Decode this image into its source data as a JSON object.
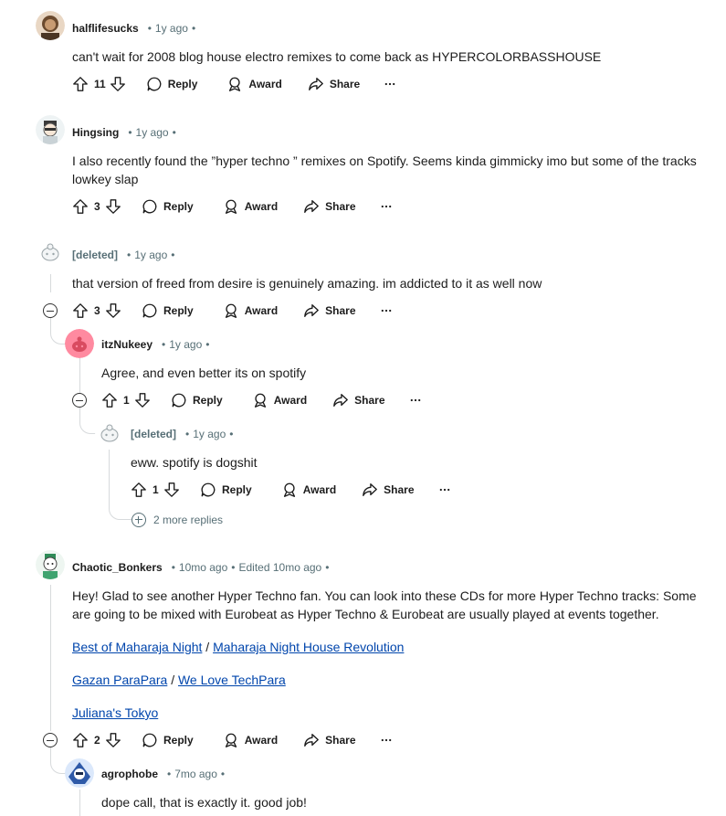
{
  "comments": [
    {
      "user": "halflifesucks",
      "time": "1y ago",
      "text": "can't wait for 2008 blog house electro remixes to come back as HYPERCOLORBASSHOUSE",
      "votes": "11"
    },
    {
      "user": "Hingsing",
      "time": "1y ago",
      "text": "I also recently found the ”hyper techno ” remixes on Spotify. Seems kinda gimmicky imo but some of the tracks lowkey slap",
      "votes": "3"
    },
    {
      "user": "[deleted]",
      "time": "1y ago",
      "text": "that version of freed from desire is genuinely amazing. im addicted to it as well now",
      "votes": "3"
    },
    {
      "user": "itzNukeey",
      "time": "1y ago",
      "text": "Agree, and even better its on spotify",
      "votes": "1"
    },
    {
      "user": "[deleted]",
      "time": "1y ago",
      "text": "eww. spotify is dogshit",
      "votes": "1"
    },
    {
      "user": "Chaotic_Bonkers",
      "time": "10mo ago",
      "edited": "Edited 10mo ago",
      "text": "Hey! Glad to see another Hyper Techno fan. You can look into these CDs for more Hyper Techno tracks: Some are going to be mixed with Eurobeat as Hyper Techno & Eurobeat are usually played at events together.",
      "links": {
        "l1a": "Best of Maharaja Night",
        "l1b": "Maharaja Night House Revolution",
        "l2a": "Gazan ParaPara",
        "l2b": "We Love TechPara",
        "l3": "Juliana's Tokyo",
        "slash": "/"
      },
      "votes": "2"
    },
    {
      "user": "agrophobe",
      "time": "7mo ago",
      "text": "dope call, that is exactly it. good job!"
    }
  ],
  "labels": {
    "reply": "Reply",
    "award": "Award",
    "share": "Share",
    "more": "···",
    "bullet": "•",
    "more_replies": "2 more replies"
  },
  "icons": [
    "upvote-icon",
    "downvote-icon",
    "reply-icon",
    "award-icon",
    "share-icon",
    "overflow-icon",
    "collapse-icon",
    "expand-icon"
  ],
  "colors": {
    "link": "#0045ac",
    "meta": "#576f76",
    "thread": "#d7dadc"
  }
}
